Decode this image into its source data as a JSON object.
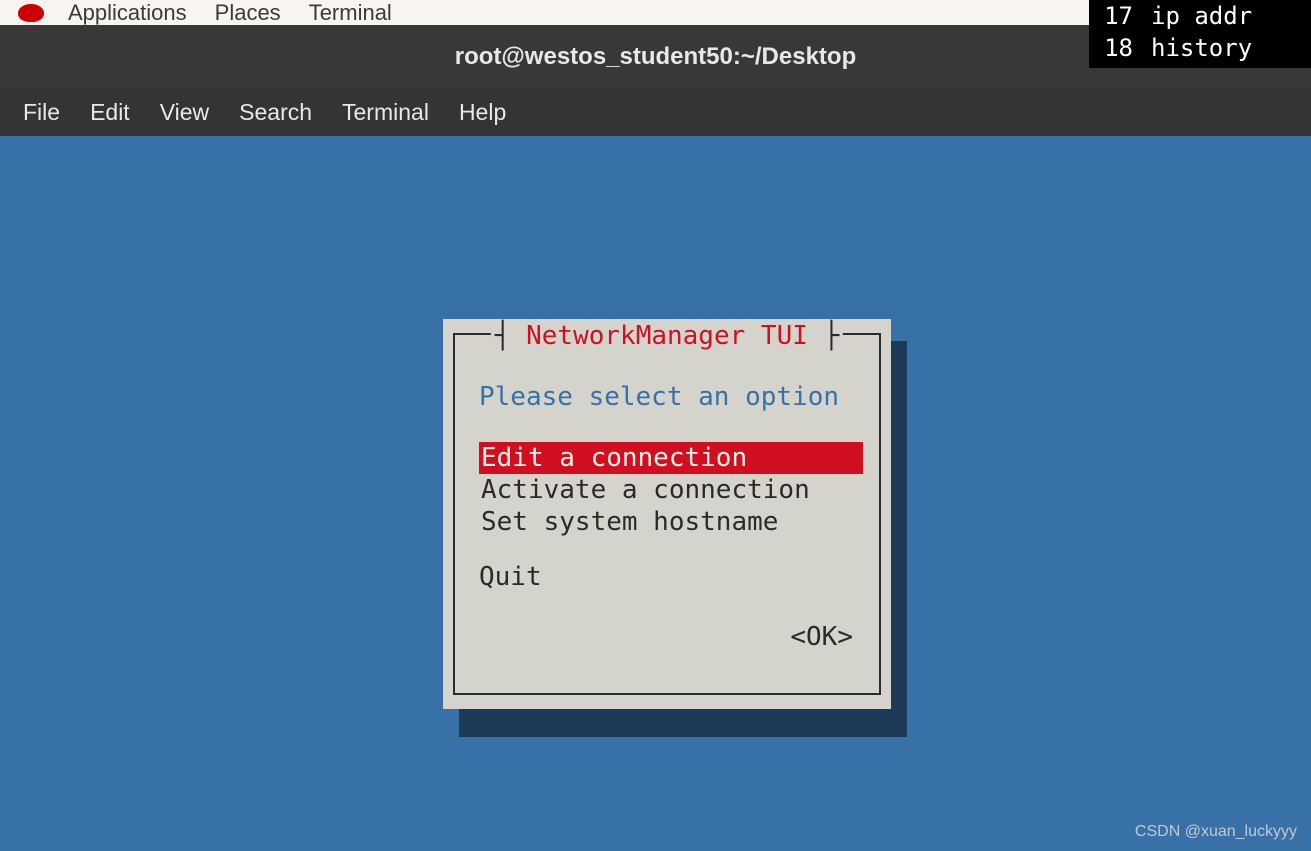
{
  "gnome_panel": {
    "applications": "Applications",
    "places": "Places",
    "terminal": "Terminal"
  },
  "window": {
    "title": "root@westos_student50:~/Desktop"
  },
  "menu_bar": {
    "file": "File",
    "edit": "Edit",
    "view": "View",
    "search": "Search",
    "terminal": "Terminal",
    "help": "Help"
  },
  "tui": {
    "title": "NetworkManager TUI",
    "prompt": "Please select an option",
    "options": {
      "edit": "Edit a connection",
      "activate": "Activate a connection",
      "hostname": "Set system hostname"
    },
    "quit": "Quit",
    "ok": "<OK>"
  },
  "overlay": {
    "line1_num": "17",
    "line1_cmd": "ip addr",
    "line2_num": "18",
    "line2_cmd": "history"
  },
  "watermark": "CSDN @xuan_luckyyy"
}
